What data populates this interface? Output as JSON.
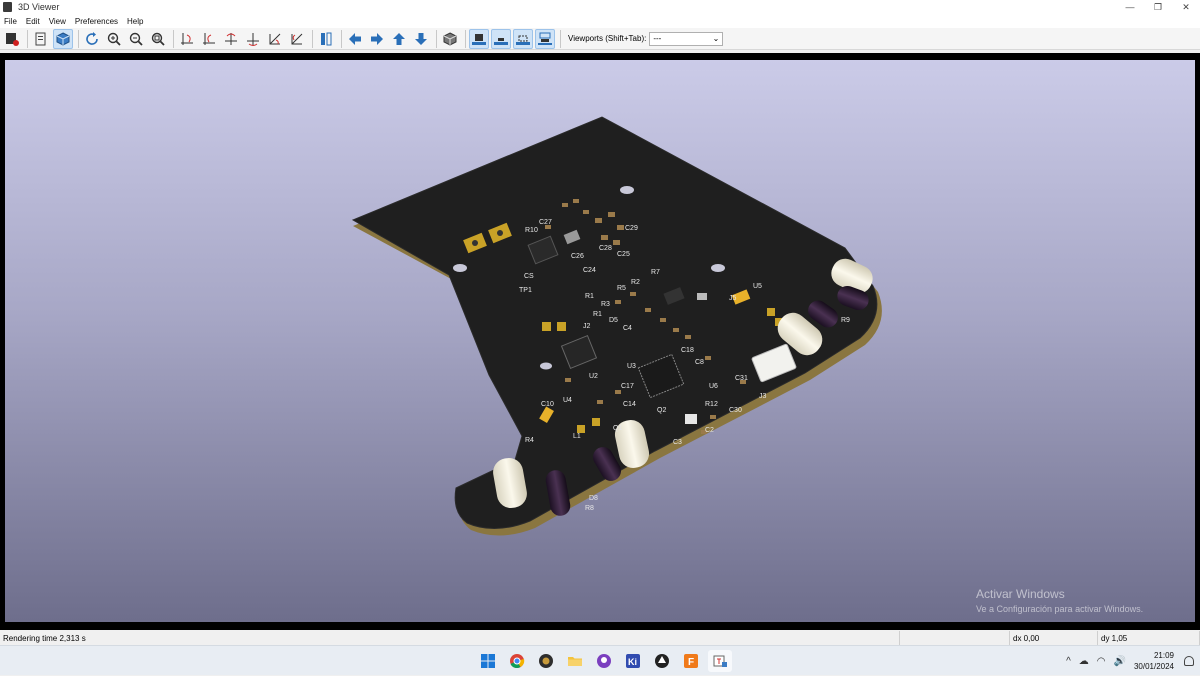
{
  "window": {
    "title": "3D Viewer",
    "minimize_glyph": "—",
    "restore_glyph": "❐",
    "close_glyph": "✕"
  },
  "menu": [
    "File",
    "Edit",
    "View",
    "Preferences",
    "Help"
  ],
  "toolbar": {
    "viewports_label": "Viewports (Shift+Tab):",
    "viewports_value": "---",
    "icons": [
      "render-options-icon",
      "copy-image-icon",
      "raytrace-toggle-icon",
      "reload-icon",
      "zoom-in-icon",
      "zoom-out-icon",
      "zoom-fit-icon",
      "rotate-x-cw-icon",
      "rotate-x-ccw-icon",
      "rotate-y-cw-icon",
      "rotate-y-ccw-icon",
      "rotate-z-cw-icon",
      "rotate-z-ccw-icon",
      "flip-board-icon",
      "pan-left-icon",
      "pan-right-icon",
      "pan-up-icon",
      "pan-down-icon",
      "ortho-toggle-icon",
      "show-tht-icon",
      "show-smd-icon",
      "show-virtual-icon",
      "show-not-in-posfile-icon"
    ]
  },
  "viewport": {
    "bg_top": "#cbcbe8",
    "bg_bottom": "#6e6e8c",
    "board_color": "#1f1f1f",
    "silkscreen_labels": [
      "TP1",
      "CS",
      "C27",
      "R10",
      "C26",
      "C28",
      "C29",
      "C24",
      "C25",
      "R1",
      "R3",
      "R5",
      "R2",
      "R7",
      "D5",
      "R1",
      "J2",
      "C4",
      "U2",
      "U3",
      "C18",
      "C8",
      "C17",
      "C14",
      "U6",
      "C31",
      "C30",
      "J3",
      "C10",
      "U4",
      "R4",
      "L1",
      "Q1",
      "Q2",
      "R12",
      "C2",
      "D8",
      "R8",
      "R9",
      "J5",
      "U5",
      "C3"
    ]
  },
  "watermark": {
    "title": "Activar Windows",
    "subtitle": "Ve a Configuración para activar Windows."
  },
  "status": {
    "render_time": "Rendering time 2,313 s",
    "dx": "dx 0,00",
    "dy": "dy 1,05"
  },
  "taskbar": {
    "apps": [
      "windows-start-icon",
      "chrome-icon",
      "camera-app-icon",
      "file-explorer-icon",
      "github-icon",
      "kicad-icon",
      "inkscape-icon",
      "fusion-icon",
      "kicad-3d-viewer-icon"
    ],
    "tray": {
      "up_arrow": "^",
      "cloud": "☁",
      "wifi": "◠",
      "volume": "🔊",
      "time": "21:09",
      "date": "30/01/2024"
    }
  }
}
